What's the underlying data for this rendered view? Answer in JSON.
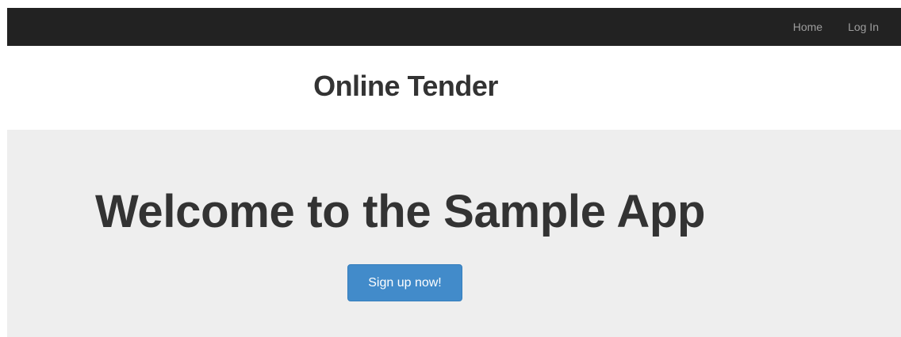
{
  "navbar": {
    "links": [
      {
        "label": "Home"
      },
      {
        "label": "Log In"
      }
    ]
  },
  "brand": {
    "title": "Online Tender"
  },
  "jumbotron": {
    "heading": "Welcome to the Sample App",
    "signup_label": "Sign up now!"
  },
  "colors": {
    "navbar_bg": "#222222",
    "nav_link": "#9d9d9d",
    "jumbotron_bg": "#eeeeee",
    "primary_button": "#428bca",
    "text": "#333333"
  }
}
